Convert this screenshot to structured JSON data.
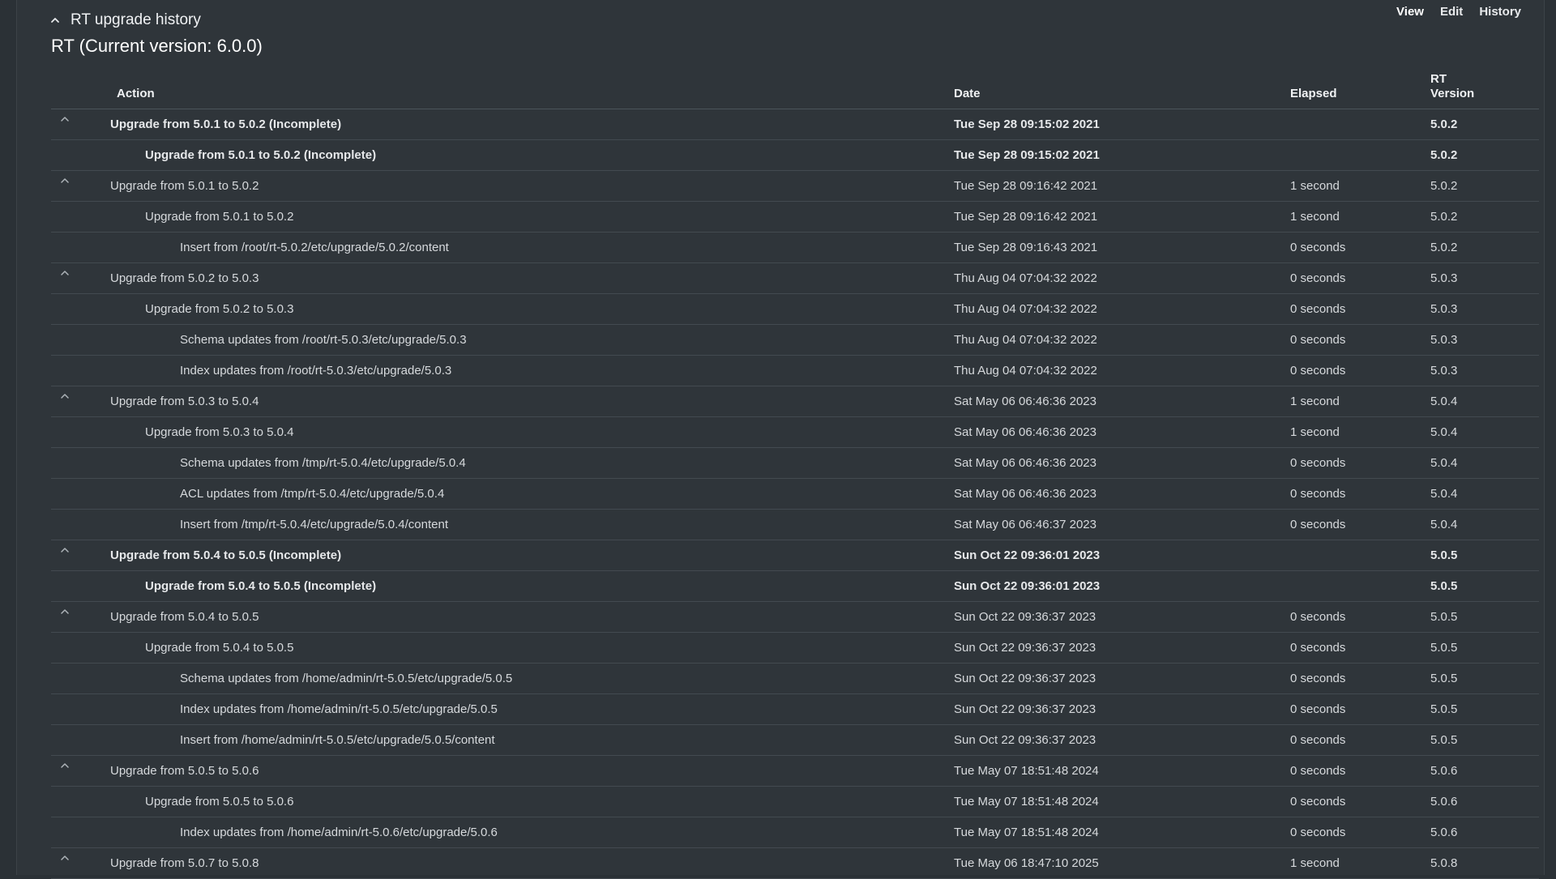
{
  "tabs": [
    "View",
    "Edit",
    "History"
  ],
  "section_title": "RT upgrade history",
  "subtitle": "RT (Current version: 6.0.0)",
  "columns": {
    "action": "Action",
    "date": "Date",
    "elapsed": "Elapsed",
    "version_line1": "RT",
    "version_line2": "Version"
  },
  "rows": [
    {
      "level": 0,
      "toggle": true,
      "bold": true,
      "action": "Upgrade from 5.0.1 to 5.0.2 (Incomplete)",
      "date": "Tue Sep 28 09:15:02 2021",
      "elapsed": "",
      "version": "5.0.2"
    },
    {
      "level": 1,
      "toggle": false,
      "bold": true,
      "action": "Upgrade from 5.0.1 to 5.0.2 (Incomplete)",
      "date": "Tue Sep 28 09:15:02 2021",
      "elapsed": "",
      "version": "5.0.2"
    },
    {
      "level": 0,
      "toggle": true,
      "bold": false,
      "action": "Upgrade from 5.0.1 to 5.0.2",
      "date": "Tue Sep 28 09:16:42 2021",
      "elapsed": "1 second",
      "version": "5.0.2"
    },
    {
      "level": 1,
      "toggle": false,
      "bold": false,
      "action": "Upgrade from 5.0.1 to 5.0.2",
      "date": "Tue Sep 28 09:16:42 2021",
      "elapsed": "1 second",
      "version": "5.0.2"
    },
    {
      "level": 2,
      "toggle": false,
      "bold": false,
      "action": "Insert from /root/rt-5.0.2/etc/upgrade/5.0.2/content",
      "date": "Tue Sep 28 09:16:43 2021",
      "elapsed": "0 seconds",
      "version": "5.0.2"
    },
    {
      "level": 0,
      "toggle": true,
      "bold": false,
      "action": "Upgrade from 5.0.2 to 5.0.3",
      "date": "Thu Aug 04 07:04:32 2022",
      "elapsed": "0 seconds",
      "version": "5.0.3"
    },
    {
      "level": 1,
      "toggle": false,
      "bold": false,
      "action": "Upgrade from 5.0.2 to 5.0.3",
      "date": "Thu Aug 04 07:04:32 2022",
      "elapsed": "0 seconds",
      "version": "5.0.3"
    },
    {
      "level": 2,
      "toggle": false,
      "bold": false,
      "action": "Schema updates from /root/rt-5.0.3/etc/upgrade/5.0.3",
      "date": "Thu Aug 04 07:04:32 2022",
      "elapsed": "0 seconds",
      "version": "5.0.3"
    },
    {
      "level": 2,
      "toggle": false,
      "bold": false,
      "action": "Index updates from /root/rt-5.0.3/etc/upgrade/5.0.3",
      "date": "Thu Aug 04 07:04:32 2022",
      "elapsed": "0 seconds",
      "version": "5.0.3"
    },
    {
      "level": 0,
      "toggle": true,
      "bold": false,
      "action": "Upgrade from 5.0.3 to 5.0.4",
      "date": "Sat May 06 06:46:36 2023",
      "elapsed": "1 second",
      "version": "5.0.4"
    },
    {
      "level": 1,
      "toggle": false,
      "bold": false,
      "action": "Upgrade from 5.0.3 to 5.0.4",
      "date": "Sat May 06 06:46:36 2023",
      "elapsed": "1 second",
      "version": "5.0.4"
    },
    {
      "level": 2,
      "toggle": false,
      "bold": false,
      "action": "Schema updates from /tmp/rt-5.0.4/etc/upgrade/5.0.4",
      "date": "Sat May 06 06:46:36 2023",
      "elapsed": "0 seconds",
      "version": "5.0.4"
    },
    {
      "level": 2,
      "toggle": false,
      "bold": false,
      "action": "ACL updates from /tmp/rt-5.0.4/etc/upgrade/5.0.4",
      "date": "Sat May 06 06:46:36 2023",
      "elapsed": "0 seconds",
      "version": "5.0.4"
    },
    {
      "level": 2,
      "toggle": false,
      "bold": false,
      "action": "Insert from /tmp/rt-5.0.4/etc/upgrade/5.0.4/content",
      "date": "Sat May 06 06:46:37 2023",
      "elapsed": "0 seconds",
      "version": "5.0.4"
    },
    {
      "level": 0,
      "toggle": true,
      "bold": true,
      "action": "Upgrade from 5.0.4 to 5.0.5 (Incomplete)",
      "date": "Sun Oct 22 09:36:01 2023",
      "elapsed": "",
      "version": "5.0.5"
    },
    {
      "level": 1,
      "toggle": false,
      "bold": true,
      "action": "Upgrade from 5.0.4 to 5.0.5 (Incomplete)",
      "date": "Sun Oct 22 09:36:01 2023",
      "elapsed": "",
      "version": "5.0.5"
    },
    {
      "level": 0,
      "toggle": true,
      "bold": false,
      "action": "Upgrade from 5.0.4 to 5.0.5",
      "date": "Sun Oct 22 09:36:37 2023",
      "elapsed": "0 seconds",
      "version": "5.0.5"
    },
    {
      "level": 1,
      "toggle": false,
      "bold": false,
      "action": "Upgrade from 5.0.4 to 5.0.5",
      "date": "Sun Oct 22 09:36:37 2023",
      "elapsed": "0 seconds",
      "version": "5.0.5"
    },
    {
      "level": 2,
      "toggle": false,
      "bold": false,
      "action": "Schema updates from /home/admin/rt-5.0.5/etc/upgrade/5.0.5",
      "date": "Sun Oct 22 09:36:37 2023",
      "elapsed": "0 seconds",
      "version": "5.0.5"
    },
    {
      "level": 2,
      "toggle": false,
      "bold": false,
      "action": "Index updates from /home/admin/rt-5.0.5/etc/upgrade/5.0.5",
      "date": "Sun Oct 22 09:36:37 2023",
      "elapsed": "0 seconds",
      "version": "5.0.5"
    },
    {
      "level": 2,
      "toggle": false,
      "bold": false,
      "action": "Insert from /home/admin/rt-5.0.5/etc/upgrade/5.0.5/content",
      "date": "Sun Oct 22 09:36:37 2023",
      "elapsed": "0 seconds",
      "version": "5.0.5"
    },
    {
      "level": 0,
      "toggle": true,
      "bold": false,
      "action": "Upgrade from 5.0.5 to 5.0.6",
      "date": "Tue May 07 18:51:48 2024",
      "elapsed": "0 seconds",
      "version": "5.0.6"
    },
    {
      "level": 1,
      "toggle": false,
      "bold": false,
      "action": "Upgrade from 5.0.5 to 5.0.6",
      "date": "Tue May 07 18:51:48 2024",
      "elapsed": "0 seconds",
      "version": "5.0.6"
    },
    {
      "level": 2,
      "toggle": false,
      "bold": false,
      "action": "Index updates from /home/admin/rt-5.0.6/etc/upgrade/5.0.6",
      "date": "Tue May 07 18:51:48 2024",
      "elapsed": "0 seconds",
      "version": "5.0.6"
    },
    {
      "level": 0,
      "toggle": true,
      "bold": false,
      "action": "Upgrade from 5.0.7 to 5.0.8",
      "date": "Tue May 06 18:47:10 2025",
      "elapsed": "1 second",
      "version": "5.0.8"
    }
  ]
}
